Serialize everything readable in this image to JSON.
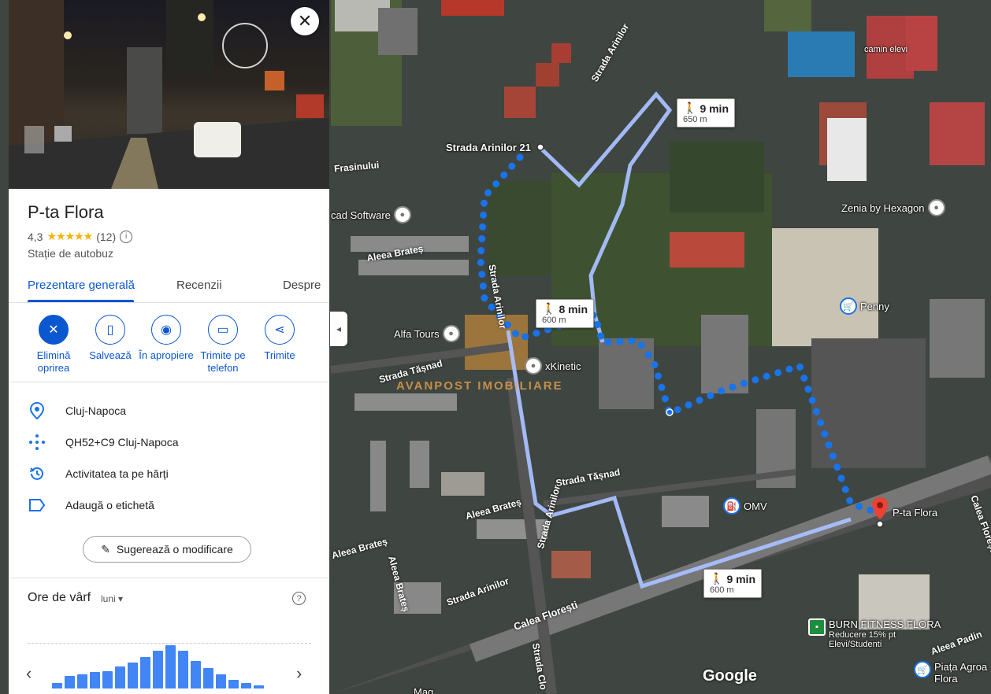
{
  "map": {
    "street_labels": [
      {
        "text": "Strada Arinilor",
        "rot": -60
      },
      {
        "text": "Strada Arinilor",
        "rot": 80
      },
      {
        "text": "Strada Arinilor",
        "rot": -75
      },
      {
        "text": "Strada Arinilor",
        "rot": -20
      },
      {
        "text": "Aleea Brateș",
        "rot": -10
      },
      {
        "text": "Aleea Brateș",
        "rot": -15
      },
      {
        "text": "Aleea Brateș",
        "rot": 75
      },
      {
        "text": "Aleea Brateș",
        "rot": -15
      },
      {
        "text": "Strada Tășnad",
        "rot": -15
      },
      {
        "text": "Strada Tășnad",
        "rot": -10
      },
      {
        "text": "Calea Florești",
        "rot": -20
      },
      {
        "text": "Frasinului",
        "rot": -5
      },
      {
        "text": "Strada Clo",
        "rot": 80
      },
      {
        "text": "Aleea Padin",
        "rot": -20
      },
      {
        "text": "Calea Florești",
        "rot": 70
      }
    ],
    "places": {
      "arinilor_stop": "Strada Arinilor 21",
      "camin": "camin elevi",
      "cad_software": "cad Software",
      "zenia": "Zenia by Hexagon",
      "alfa_tours": "Alfa Tours",
      "xkinetic": "xKinetic",
      "penny": "Penny",
      "omv": "OMV",
      "destination": "P-ta Flora",
      "burn_title": "BURN FITNESS FLORA",
      "burn_sub": "Reducere 15% pt",
      "burn_sub2": "Elevi/Studenti",
      "piata": "Piața Agroa",
      "piata2": "Flora",
      "watermark": "AVANPOST IMOBILIARE",
      "bottom_partial": "Mag"
    },
    "routes": [
      {
        "time": "9 min",
        "distance": "650 m"
      },
      {
        "time": "8 min",
        "distance": "600 m"
      },
      {
        "time": "9 min",
        "distance": "600 m"
      }
    ],
    "google": "Google",
    "collapse_arrow": "◂"
  },
  "panel": {
    "close_label": "✕",
    "title": "P-ta Flora",
    "rating": "4,3",
    "stars": "★★★★★",
    "review_count": "(12)",
    "category": "Stație de autobuz",
    "tabs": [
      "Prezentare generală",
      "Recenzii",
      "Despre"
    ],
    "actions": [
      {
        "label": "Elimină oprirea",
        "icon": "remove-stop-icon"
      },
      {
        "label": "Salvează",
        "icon": "bookmark-icon"
      },
      {
        "label": "În apropiere",
        "icon": "nearby-icon"
      },
      {
        "label": "Trimite pe telefon",
        "icon": "send-to-phone-icon"
      },
      {
        "label": "Trimite",
        "icon": "share-icon"
      }
    ],
    "info": [
      {
        "text": "Cluj-Napoca",
        "icon": "location-pin-icon"
      },
      {
        "text": "QH52+C9 Cluj-Napoca",
        "icon": "plus-code-icon"
      },
      {
        "text": "Activitatea ta pe hărți",
        "icon": "history-icon"
      },
      {
        "text": "Adaugă o etichetă",
        "icon": "label-icon"
      }
    ],
    "suggest_label": "Sugerează o modificare",
    "peak": {
      "title": "Ore de vârf",
      "day": "luni",
      "bars": [
        0.1,
        0.22,
        0.25,
        0.28,
        0.3,
        0.38,
        0.45,
        0.55,
        0.65,
        0.75,
        0.66,
        0.48,
        0.35,
        0.25,
        0.15,
        0.1,
        0.05
      ]
    },
    "prev": "‹",
    "next": "›"
  },
  "colors": {
    "accent": "#0b57d0",
    "route_blue": "#1a73e8",
    "route_gray": "#a8c0ff",
    "pin_red": "#ea4335"
  }
}
